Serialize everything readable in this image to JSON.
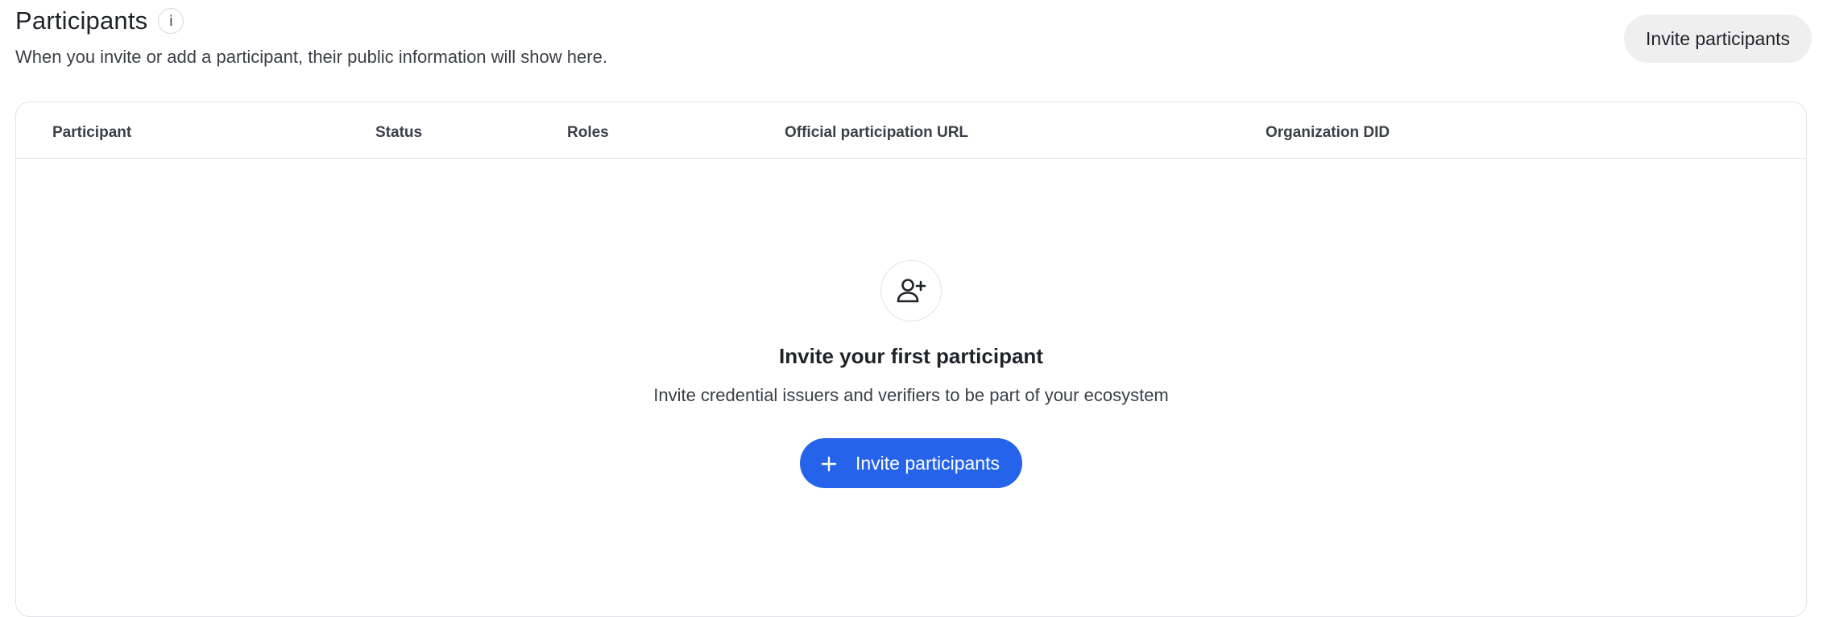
{
  "header": {
    "title": "Participants",
    "info_icon_glyph": "i",
    "subtitle": "When you invite or add a participant, their public information will show here.",
    "invite_button_label": "Invite participants"
  },
  "table": {
    "columns": [
      {
        "label": "Participant"
      },
      {
        "label": "Status"
      },
      {
        "label": "Roles"
      },
      {
        "label": "Official participation URL"
      },
      {
        "label": "Organization DID"
      }
    ],
    "rows": []
  },
  "empty_state": {
    "icon": "add-user-icon",
    "title": "Invite your first participant",
    "description": "Invite credential issuers and verifiers to be part of your ecosystem",
    "button_label": "Invite participants",
    "button_icon": "plus-icon"
  },
  "colors": {
    "primary": "#2563eb",
    "secondary_button_bg": "#efefef",
    "border": "#e2e3e6",
    "text": "#1f2328",
    "muted_text": "#3b3f46"
  }
}
